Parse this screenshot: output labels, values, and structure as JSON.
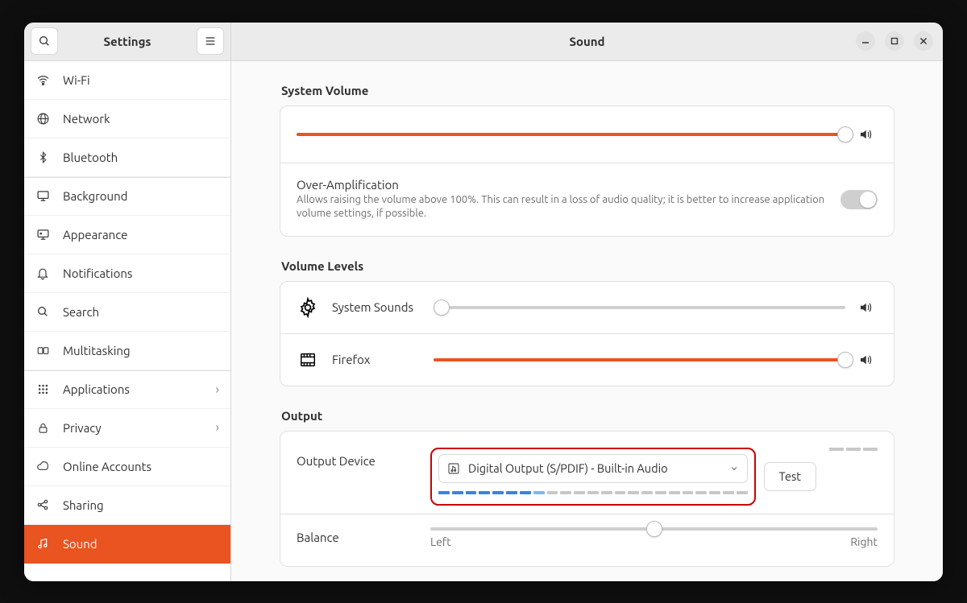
{
  "header": {
    "sidebar_title": "Settings",
    "content_title": "Sound"
  },
  "sidebar": {
    "items": [
      {
        "label": "Wi-Fi",
        "icon": "wifi"
      },
      {
        "label": "Network",
        "icon": "globe"
      },
      {
        "label": "Bluetooth",
        "icon": "bluetooth"
      },
      {
        "label": "Background",
        "icon": "display",
        "sep": true
      },
      {
        "label": "Appearance",
        "icon": "appearance"
      },
      {
        "label": "Notifications",
        "icon": "bell"
      },
      {
        "label": "Search",
        "icon": "search"
      },
      {
        "label": "Multitasking",
        "icon": "multitask"
      },
      {
        "label": "Applications",
        "icon": "grid",
        "arrow": true,
        "sep": true
      },
      {
        "label": "Privacy",
        "icon": "lock",
        "arrow": true
      },
      {
        "label": "Online Accounts",
        "icon": "cloud"
      },
      {
        "label": "Sharing",
        "icon": "share"
      },
      {
        "label": "Sound",
        "icon": "sound",
        "active": true
      }
    ]
  },
  "sections": {
    "system_volume": {
      "title": "System Volume",
      "level_percent": 100,
      "overamp_title": "Over-Amplification",
      "overamp_desc": "Allows raising the volume above 100%. This can result in a loss of audio quality; it is better to increase application volume settings, if possible.",
      "overamp_enabled": false
    },
    "volume_levels": {
      "title": "Volume Levels",
      "apps": [
        {
          "name": "System Sounds",
          "icon": "gear",
          "level_percent": 2
        },
        {
          "name": "Firefox",
          "icon": "film",
          "level_percent": 100
        }
      ]
    },
    "output": {
      "title": "Output",
      "device_label": "Output Device",
      "selected_device": "Digital Output (S/PDIF) - Built-in Audio",
      "test_label": "Test",
      "meter_active_segments": 7,
      "meter_total_segments": 23,
      "balance_label": "Balance",
      "balance_left": "Left",
      "balance_right": "Right",
      "balance_value_percent": 50
    }
  }
}
